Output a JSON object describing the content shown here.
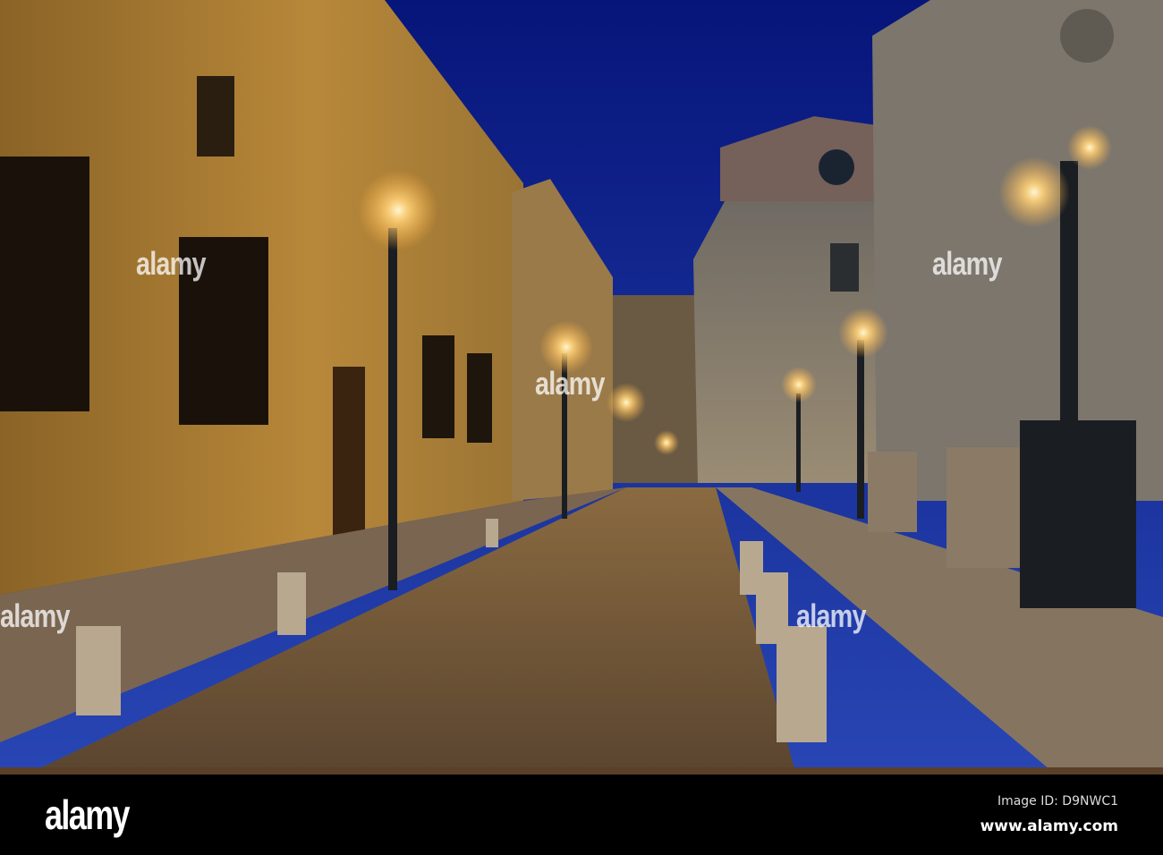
{
  "photo": {
    "subject": "Street at dusk with lamps",
    "colors": {
      "sky_top": "#06157a",
      "sky_bottom": "#2846b4",
      "left_building": "#a4792f",
      "stone_right": "#8a8272",
      "street": "#6e5434",
      "lamp_glow": "#ffd27a"
    }
  },
  "watermark": {
    "text": "alamy"
  },
  "footer": {
    "logo": "alamy",
    "image_id": "Image ID: D9NWC1",
    "website": "www.alamy.com"
  }
}
